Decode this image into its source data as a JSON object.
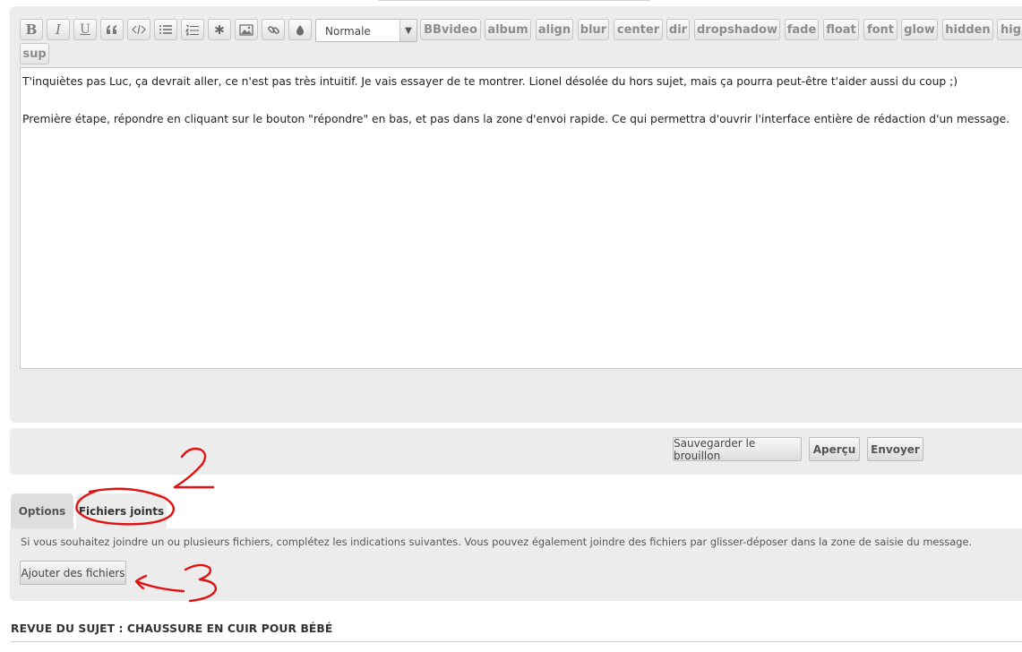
{
  "toolbar": {
    "icons": [
      "bold-icon",
      "italic-icon",
      "underline-icon",
      "quote-icon",
      "code-icon",
      "bullet-list-icon",
      "numbered-list-icon",
      "list-item-icon",
      "image-icon",
      "link-icon",
      "color-icon"
    ],
    "bold_glyph": "B",
    "italic_glyph": "I",
    "underline_glyph": "U",
    "font_size": {
      "selected": "Normale"
    },
    "bbcodes": [
      "BBvideo",
      "album",
      "align",
      "blur",
      "center",
      "dir",
      "dropshadow",
      "fade",
      "float",
      "font",
      "glow",
      "hidden",
      "highlight",
      "sup"
    ]
  },
  "message": {
    "lines": [
      "T'inquiètes pas Luc, ça devrait aller, ce n'est pas très intuitif. Je vais essayer de te montrer. Lionel désolée du hors sujet, mais ça pourra peut-être t'aider aussi du coup ;)",
      "",
      "Première étape, répondre en cliquant sur le bouton \"répondre\" en bas, et pas dans la zone d'envoi rapide. Ce qui permettra d'ouvrir l'interface entière de rédaction d'un message."
    ]
  },
  "actions": {
    "save_draft": "Sauvegarder le brouillon",
    "preview": "Aperçu",
    "submit": "Envoyer"
  },
  "tabs": {
    "options": "Options",
    "attachments": "Fichiers joints"
  },
  "attachments": {
    "hint": "Si vous souhaitez joindre un ou plusieurs fichiers, complétez les indications suivantes. Vous pouvez également joindre des fichiers par glisser-déposer dans la zone de saisie du message.",
    "add_button": "Ajouter des fichiers"
  },
  "review": {
    "title": "REVUE DU SUJET : CHAUSSURE EN CUIR POUR BÉBÉ"
  },
  "colors": {
    "annotation": "#e01212",
    "panel": "#ececec"
  }
}
